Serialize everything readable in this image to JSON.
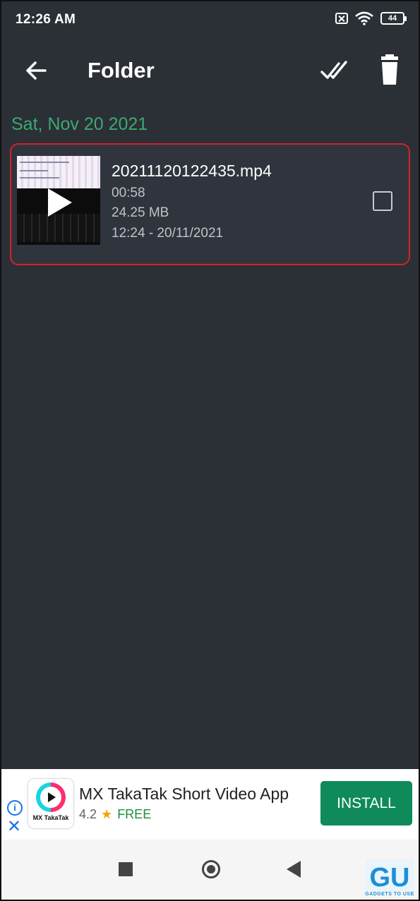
{
  "status_bar": {
    "time": "12:26 AM",
    "battery": "44"
  },
  "toolbar": {
    "title": "Folder"
  },
  "section": {
    "date_header": "Sat, Nov 20 2021"
  },
  "file": {
    "name": "20211120122435.mp4",
    "duration": "00:58",
    "size": "24.25 MB",
    "modified": "12:24 - 20/11/2021",
    "selected": false
  },
  "ad": {
    "info_icon": "i",
    "close_icon": "✕",
    "logo_text": "MX TakaTak",
    "title": "MX TakaTak Short Video App",
    "rating": "4.2",
    "star": "★",
    "price": "FREE",
    "install_label": "INSTALL"
  },
  "watermark": {
    "logo": "GU",
    "text": "GADGETS TO USE"
  },
  "colors": {
    "background": "#2b2f36",
    "accent_green": "#3aaa70",
    "highlight_red": "#d8202a",
    "install_green": "#0f8a5a"
  }
}
